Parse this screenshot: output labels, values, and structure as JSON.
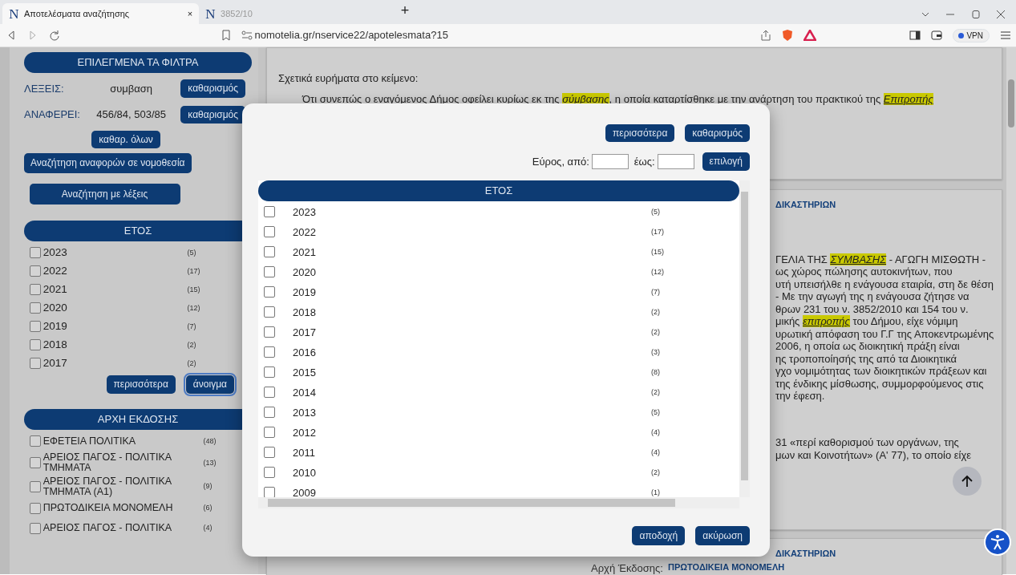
{
  "browser": {
    "tabs": [
      {
        "logo": "N",
        "title": "Αποτελέσματα αναζήτησης",
        "selected": true,
        "close": "×"
      },
      {
        "logo": "N",
        "title": "3852/10",
        "selected": false
      }
    ],
    "new_tab": "+",
    "url": "nomotelia.gr/nservice22/apotelesmata?15",
    "vpn": "VPN"
  },
  "sidebar": {
    "filters_title": "ΕΠΙΛΕΓΜΕΝΑ ΤΑ ΦΙΛΤΡΑ",
    "filters": [
      {
        "label": "ΛΕΞΕΙΣ:",
        "value": "συμβαση",
        "button": "καθαρισμός"
      },
      {
        "label": "ΑΝΑΦΕΡΕΙ:",
        "value": "456/84, 503/85",
        "button": "καθαρισμός"
      }
    ],
    "clear_all": "καθαρ. όλων",
    "search_buttons": [
      "Αναζήτηση αναφορών σε νομοθεσία",
      "Αναζήτηση με λέξεις"
    ],
    "groups": [
      {
        "title": "ΕΤΟΣ",
        "items": [
          {
            "label": "2023",
            "count": "(5)",
            "checked": false
          },
          {
            "label": "2022",
            "count": "(17)",
            "checked": false
          },
          {
            "label": "2021",
            "count": "(15)",
            "checked": false
          },
          {
            "label": "2020",
            "count": "(12)",
            "checked": false
          },
          {
            "label": "2019",
            "count": "(7)",
            "checked": false
          },
          {
            "label": "2018",
            "count": "(2)",
            "checked": false
          },
          {
            "label": "2017",
            "count": "(2)",
            "checked": false
          }
        ],
        "buttons": [
          {
            "label": "περισσότερα",
            "focused": false
          },
          {
            "label": "άνοιγμα",
            "focused": true
          }
        ]
      },
      {
        "title": "ΑΡΧΗ ΕΚΔΟΣΗΣ",
        "items": [
          {
            "label": "ΕΦΕΤΕΙΑ ΠΟΛΙΤΙΚΑ",
            "count": "(48)",
            "checked": false
          },
          {
            "label": "ΑΡΕΙΟΣ ΠΑΓΟΣ - ΠΟΛΙΤΙΚΑ ΤΜΗΜΑΤΑ",
            "count": "(13)",
            "checked": false
          },
          {
            "label": "ΑΡΕΙΟΣ ΠΑΓΟΣ - ΠΟΛΙΤΙΚΑ ΤΜΗΜΑΤΑ (Α1)",
            "count": "(9)",
            "checked": false
          },
          {
            "label": "ΠΡΩΤΟΔΙΚΕΙΑ ΜΟΝΟΜΕΛΗ",
            "count": "(6)",
            "checked": false
          },
          {
            "label": "ΑΡΕΙΟΣ ΠΑΓΟΣ - ΠΟΛΙΤΙΚΑ",
            "count": "(4)",
            "checked": false
          }
        ]
      }
    ]
  },
  "results": {
    "excerpt_heading": "Σχετικά ευρήματα στο κείμενο:",
    "excerpt": "Ότι συνεπώς ο εναγόμενος Δήμος οφείλει κυρίως εκ της *σύμβασης*, η οποία καταρτίσθηκε με την ανάρτηση του πρακτικού της *Επιτροπής*",
    "card_title": "ΔΙΚΑΣΤΗΡΙΩΝ",
    "text_lines": [
      "ΓΕΛΙΑ ΤΗΣ *ΣΥΜΒΑΣΗΣ* - ΑΓΩΓΗ ΜΙΣΘΩΤΗ -",
      "ως χώρος πώλησης αυτοκινήτων, που",
      "υτή υπεισήλθε η ενάγουσα εταιρία, στη δε θέση",
      "- Με την αγωγή της η ενάγουσα ζήτησε να",
      "θρων 231 του ν. 3852/2010 και 154 του ν.",
      "μικής *επιτροπής* του Δήμου, είχε νόμιμη",
      "υρωτική απόφαση του Γ.Γ της Αποκεντρωμένης",
      "2006, η οποία ως διοικητική πράξη είναι",
      "ης τροποποίησής της από τα Διοικητικά",
      "γχο νομιμότητας των διοικητικών πράξεων και",
      "της ένδικης μίσθωσης, συμμορφούμενος στις",
      "την έφεση."
    ],
    "more_lines": [
      "31 «περί καθορισμού των οργάνων, της",
      "μων και Κοινοτήτων» (Α' 77), το οποίο είχε"
    ],
    "next_title": "ΔΙΚΑΣΤΗΡΙΩΝ",
    "next_label": "Αρχή Έκδοσης:",
    "next_value": "ΠΡΩΤΟΔΙΚΕΙΑ ΜΟΝΟΜΕΛΗ"
  },
  "modal": {
    "top_buttons": [
      "περισσότερα",
      "καθαρισμός"
    ],
    "range_from": "Εύρος, από:",
    "range_to": "έως:",
    "apply": "επιλογή",
    "title": "ΕΤΟΣ",
    "items": [
      {
        "label": "2023",
        "count": "(5)",
        "checked": false
      },
      {
        "label": "2022",
        "count": "(17)",
        "checked": false
      },
      {
        "label": "2021",
        "count": "(15)",
        "checked": false
      },
      {
        "label": "2020",
        "count": "(12)",
        "checked": false
      },
      {
        "label": "2019",
        "count": "(7)",
        "checked": false
      },
      {
        "label": "2018",
        "count": "(2)",
        "checked": false
      },
      {
        "label": "2017",
        "count": "(2)",
        "checked": false
      },
      {
        "label": "2016",
        "count": "(3)",
        "checked": false
      },
      {
        "label": "2015",
        "count": "(8)",
        "checked": false
      },
      {
        "label": "2014",
        "count": "(2)",
        "checked": false
      },
      {
        "label": "2013",
        "count": "(5)",
        "checked": false
      },
      {
        "label": "2012",
        "count": "(4)",
        "checked": false
      },
      {
        "label": "2011",
        "count": "(4)",
        "checked": false
      },
      {
        "label": "2010",
        "count": "(2)",
        "checked": false
      },
      {
        "label": "2009",
        "count": "(1)",
        "checked": false
      }
    ],
    "bottom_buttons": [
      "αποδοχή",
      "ακύρωση"
    ]
  }
}
